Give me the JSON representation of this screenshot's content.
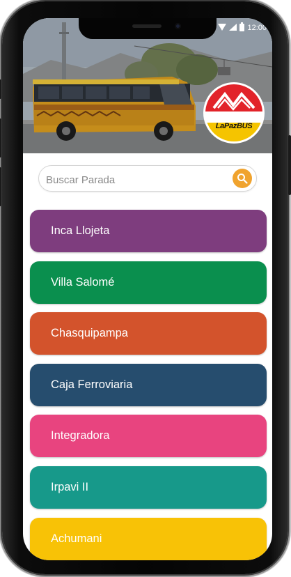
{
  "status_bar": {
    "time": "12:00"
  },
  "brand": {
    "logo_text": "LaPazBUS"
  },
  "search": {
    "placeholder": "Buscar Parada",
    "value": ""
  },
  "routes": [
    {
      "label": "Inca Llojeta",
      "color": "#7e3d7e"
    },
    {
      "label": "Villa Salomé",
      "color": "#0a8f4e"
    },
    {
      "label": "Chasquipampa",
      "color": "#d3532c"
    },
    {
      "label": "Caja Ferroviaria",
      "color": "#264d6e"
    },
    {
      "label": "Integradora",
      "color": "#e8447f"
    },
    {
      "label": "Irpavi II",
      "color": "#17998a"
    },
    {
      "label": "Achumani",
      "color": "#f8c206"
    }
  ],
  "colors": {
    "search_button": "#f0a32e",
    "logo_red": "#e2232a",
    "logo_yellow": "#f5c400"
  }
}
